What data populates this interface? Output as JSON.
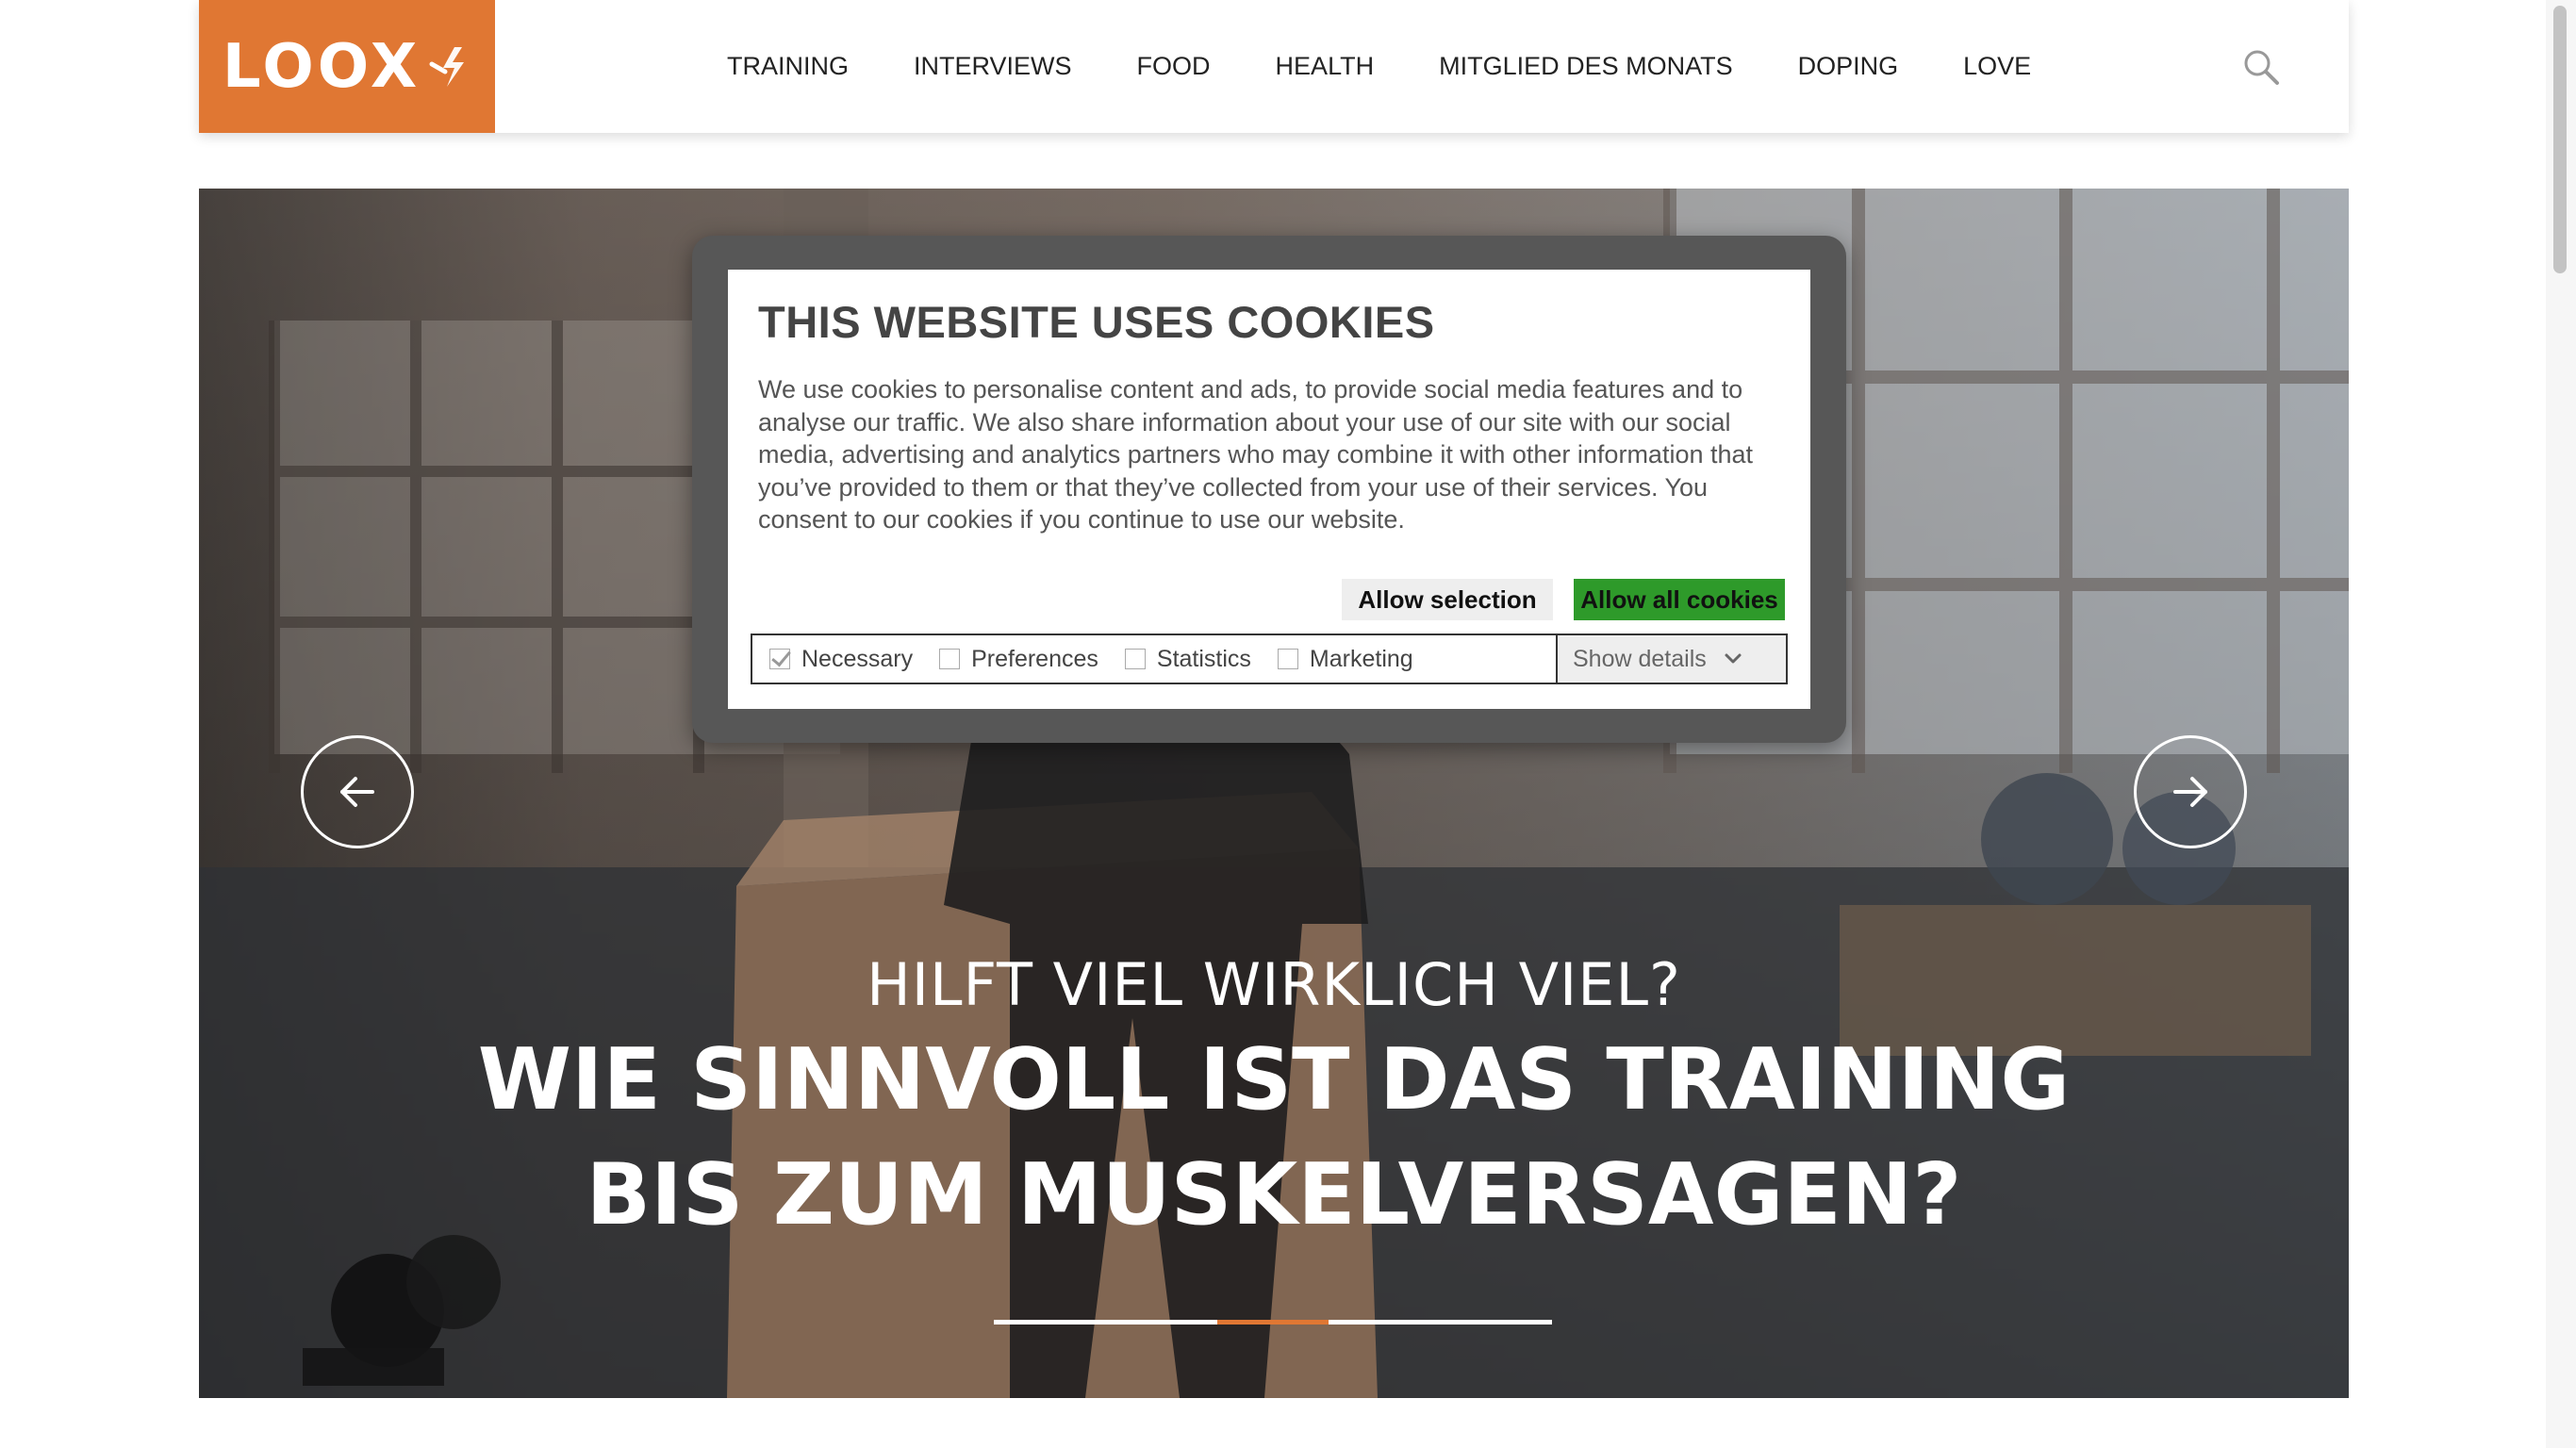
{
  "header": {
    "logo_text": "LOOX",
    "nav": [
      {
        "label": "TRAINING"
      },
      {
        "label": "INTERVIEWS"
      },
      {
        "label": "FOOD"
      },
      {
        "label": "HEALTH"
      },
      {
        "label": "MITGLIED DES MONATS"
      },
      {
        "label": "DOPING"
      },
      {
        "label": "LOVE"
      }
    ],
    "search_icon": "search-icon"
  },
  "hero": {
    "kicker": "HILFT VIEL WIRKLICH VIEL?",
    "title_line1": "WIE SINNVOLL IST DAS TRAINING",
    "title_line2": "BIS ZUM MUSKELVERSAGEN?",
    "prev_icon": "arrow-left-icon",
    "next_icon": "arrow-right-icon",
    "slides": 3,
    "active_slide": 2
  },
  "cookie": {
    "title": "THIS WEBSITE USES COOKIES",
    "text": "We use cookies to personalise content and ads, to provide social media features and to analyse our traffic. We also share information about your use of our site with our social media, advertising and analytics partners who may combine it with other information that you’ve provided to them or that they’ve collected from your use of their services. You consent to our cookies if you continue to use our website.",
    "allow_selection": "Allow selection",
    "allow_all": "Allow all cookies",
    "options": [
      {
        "label": "Necessary",
        "checked": true
      },
      {
        "label": "Preferences",
        "checked": false
      },
      {
        "label": "Statistics",
        "checked": false
      },
      {
        "label": "Marketing",
        "checked": false
      }
    ],
    "show_details": "Show details"
  },
  "colors": {
    "brand": "#e07733",
    "allow_all_green": "#2e9a2a",
    "banner_frame": "#575757"
  }
}
